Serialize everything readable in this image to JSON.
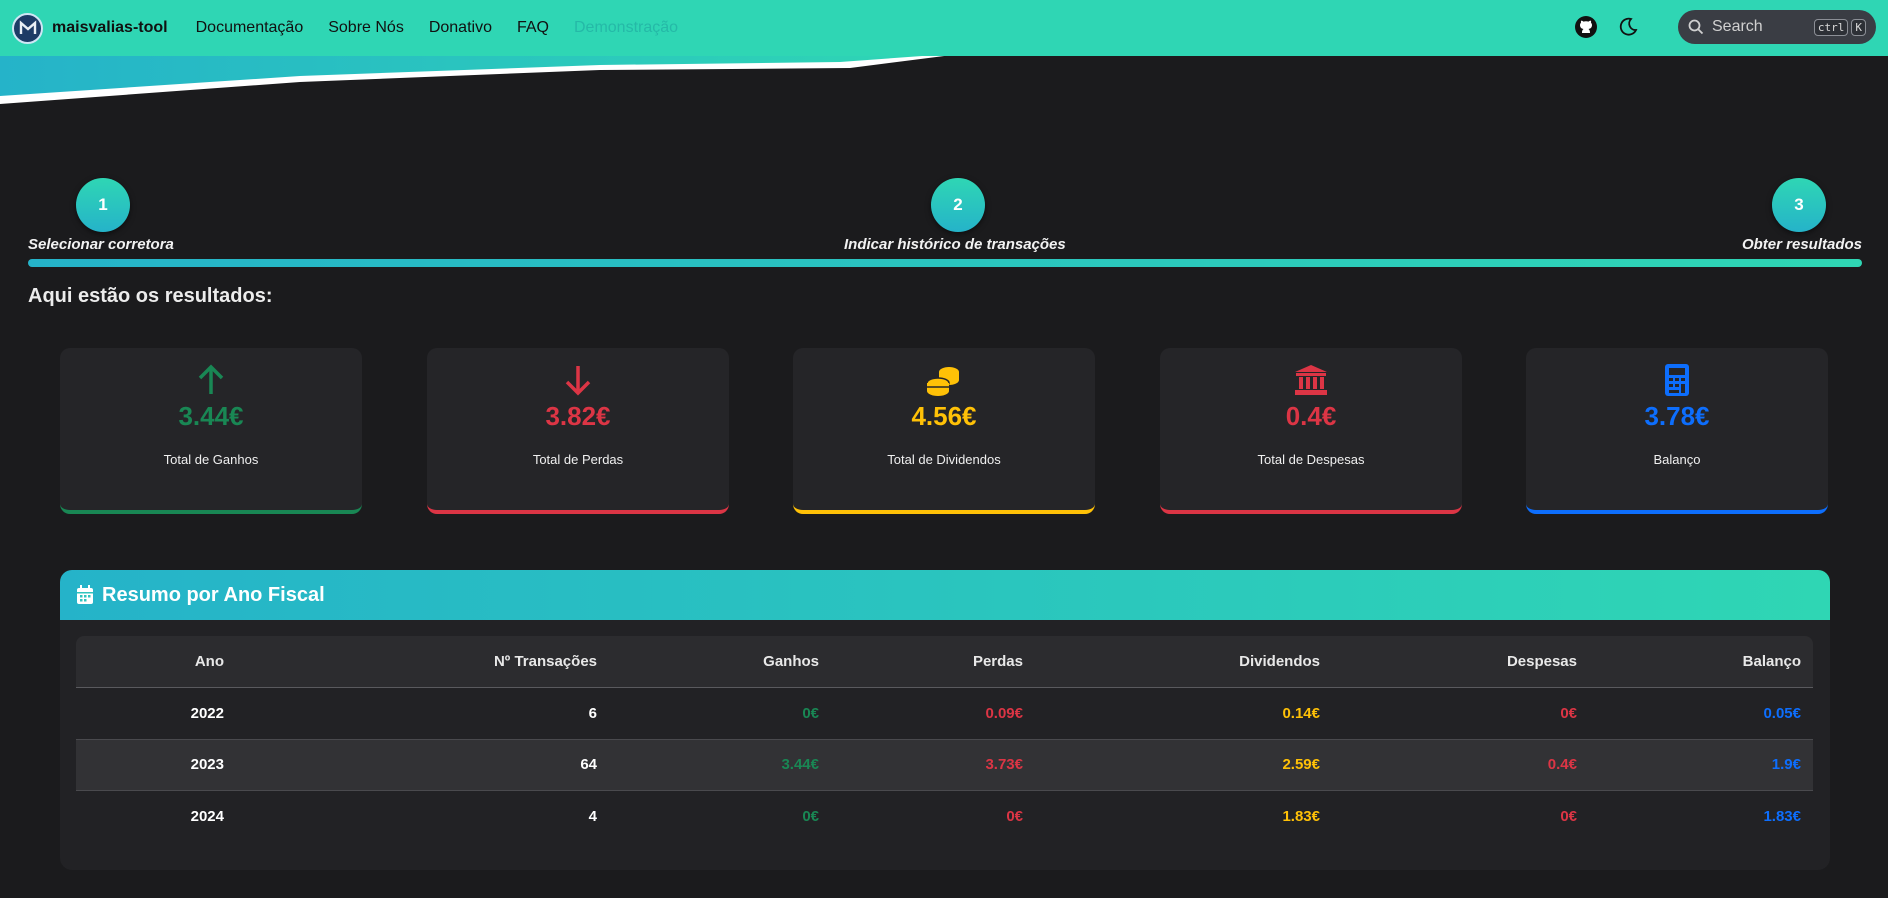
{
  "navbar": {
    "brand": "maisvalias-tool",
    "links": [
      "Documentação",
      "Sobre Nós",
      "Donativo",
      "FAQ",
      "Demonstração"
    ],
    "search_placeholder": "Search",
    "shortcut_keys": [
      "ctrl",
      "K"
    ]
  },
  "stepper": {
    "steps": [
      {
        "number": "1",
        "label": "Selecionar corretora"
      },
      {
        "number": "2",
        "label": "Indicar histórico de transações"
      },
      {
        "number": "3",
        "label": "Obter resultados"
      }
    ]
  },
  "results_title": "Aqui estão os resultados:",
  "cards": [
    {
      "icon": "arrow-up-icon",
      "value": "3.44€",
      "label": "Total de Ganhos",
      "color": "#198754"
    },
    {
      "icon": "arrow-down-icon",
      "value": "3.82€",
      "label": "Total de Perdas",
      "color": "#dc3545"
    },
    {
      "icon": "coins-icon",
      "value": "4.56€",
      "label": "Total de Dividendos",
      "color": "#ffc107"
    },
    {
      "icon": "bank-icon",
      "value": "0.4€",
      "label": "Total de Despesas",
      "color": "#dc3545"
    },
    {
      "icon": "calculator-icon",
      "value": "3.78€",
      "label": "Balanço",
      "color": "#0d6efd"
    }
  ],
  "summary": {
    "title": "Resumo por Ano Fiscal",
    "columns": [
      "Ano",
      "Nº Transações",
      "Ganhos",
      "Perdas",
      "Dividendos",
      "Despesas",
      "Balanço"
    ],
    "rows": [
      [
        "2022",
        "6",
        "0€",
        "0.09€",
        "0.14€",
        "0€",
        "0.05€"
      ],
      [
        "2023",
        "64",
        "3.44€",
        "3.73€",
        "2.59€",
        "0.4€",
        "1.9€"
      ],
      [
        "2024",
        "4",
        "0€",
        "0€",
        "1.83€",
        "0€",
        "1.83€"
      ]
    ]
  }
}
